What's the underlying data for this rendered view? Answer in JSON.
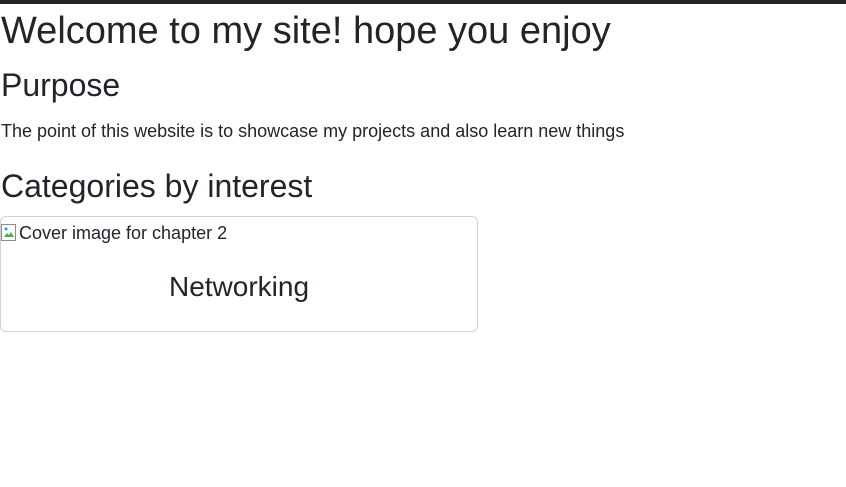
{
  "page": {
    "welcome_heading": "Welcome to my site! hope you enjoy",
    "purpose_heading": "Purpose",
    "purpose_text": "The point of this website is to showcase my projects and also learn new things",
    "categories_heading": "Categories by interest"
  },
  "cards": [
    {
      "image_alt": "Cover image for chapter 2",
      "title": "Networking"
    }
  ]
}
